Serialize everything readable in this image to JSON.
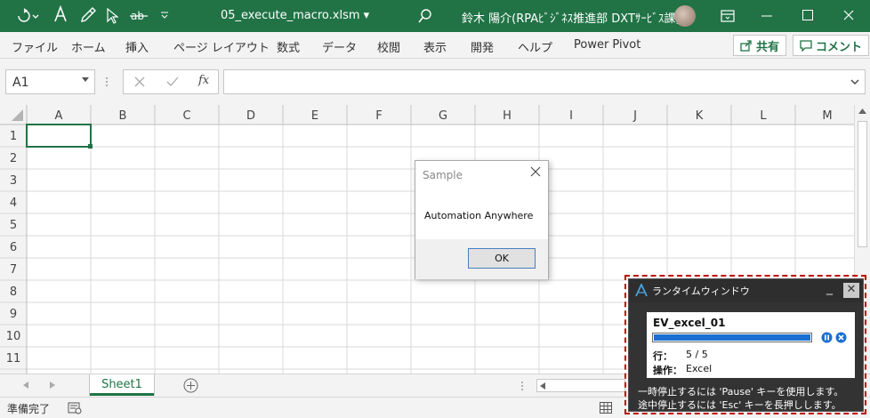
{
  "titlebar": {
    "filename": "05_execute_macro.xlsm",
    "user": "鈴木 陽介(RPAﾋﾞｼﾞﾈｽ推進部 DXTｻｰﾋﾞｽ課)"
  },
  "ribbon": {
    "tabs": [
      "ファイル",
      "ホーム",
      "挿入",
      "ページ レイアウト",
      "数式",
      "データ",
      "校閲",
      "表示",
      "開発",
      "ヘルプ",
      "Power Pivot"
    ],
    "share_label": "共有",
    "comment_label": "コメント"
  },
  "formula": {
    "name_box": "A1",
    "fx_label": "fx"
  },
  "grid": {
    "columns": [
      "A",
      "B",
      "C",
      "D",
      "E",
      "F",
      "G",
      "H",
      "I",
      "J",
      "K",
      "L",
      "M"
    ],
    "rows": [
      "1",
      "2",
      "3",
      "4",
      "5",
      "6",
      "7",
      "8",
      "9",
      "10",
      "11"
    ]
  },
  "sheets": {
    "active": "Sheet1"
  },
  "status": {
    "text": "準備完了"
  },
  "dialog": {
    "title": "Sample",
    "message": "Automation Anywhere",
    "ok_label": "OK"
  },
  "runtime": {
    "title": "ランタイムウィンドウ",
    "task_name": "EV_excel_01",
    "row_label": "行：",
    "row_value": "5 / 5",
    "progress": 1.0,
    "op_label": "操作：",
    "op_value": "Excel",
    "help_pause": "一時停止するには 'Pause' キーを使用します。",
    "help_stop": "途中停止するには 'Esc' キーを長押しします。"
  },
  "colors": {
    "excel_green": "#217346",
    "highlight_red": "#c00000",
    "progress_blue": "#1a6fd1"
  }
}
